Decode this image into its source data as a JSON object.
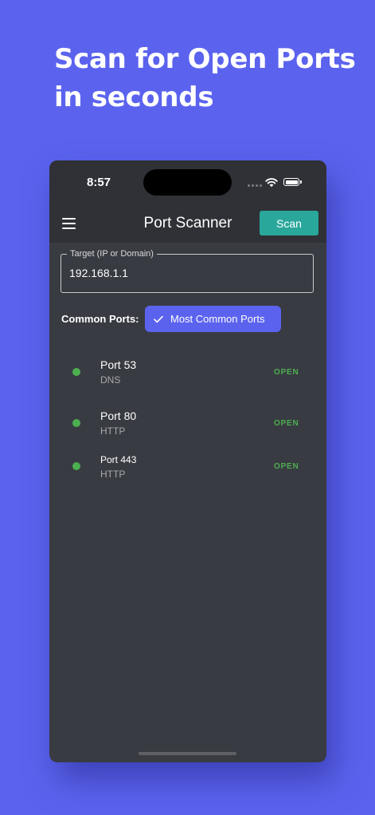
{
  "promo": {
    "headline_line1": "Scan for Open Ports",
    "headline_line2": "in seconds"
  },
  "status_bar": {
    "time": "8:57",
    "icons": [
      "cellular-signal-icon",
      "wifi-icon",
      "battery-icon"
    ]
  },
  "app_bar": {
    "menu_icon": "hamburger-menu-icon",
    "title": "Port Scanner",
    "scan_label": "Scan"
  },
  "target": {
    "label": "Target (IP or Domain)",
    "value": "192.168.1.1"
  },
  "common_ports": {
    "label": "Common Ports:",
    "chip_label": "Most Common Ports",
    "chip_icon": "checkmark-icon",
    "chip_selected": true
  },
  "ports": [
    {
      "port": "Port 53",
      "service": "DNS",
      "status": "OPEN"
    },
    {
      "port": "Port 80",
      "service": "HTTP",
      "status": "OPEN"
    },
    {
      "port": "Port 443",
      "service": "HTTP",
      "status": "OPEN"
    }
  ],
  "colors": {
    "background": "#5b63ee",
    "app_surface": "#393b42",
    "app_bar": "#2f3136",
    "scan_button": "#2aa79b",
    "chip": "#5b63ee",
    "open_status": "#4caf50"
  }
}
